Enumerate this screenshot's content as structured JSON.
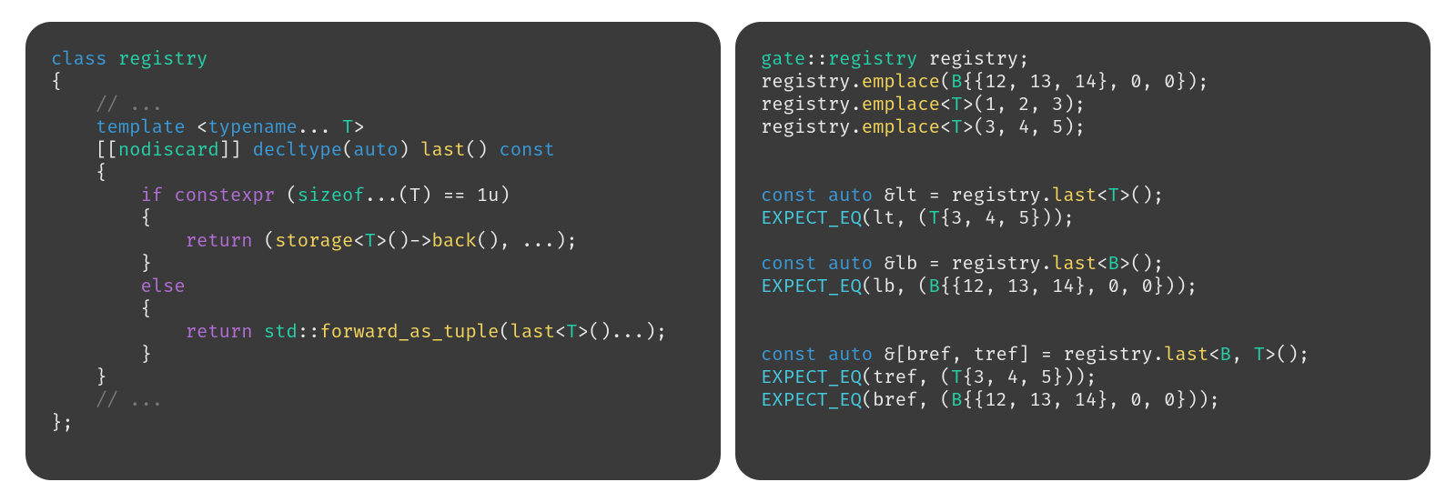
{
  "left": {
    "l1_class": "class",
    "l1_name": " registry",
    "l2": "{",
    "l3_indent": "    ",
    "l3_cm": "// ...",
    "l4_indent": "    ",
    "l4_tmpl": "template",
    "l4_open": " <",
    "l4_typename": "typename",
    "l4_dots": "...",
    "l4_T": " T",
    "l4_close": ">",
    "l5_indent": "    ",
    "l5_attr_open": "[[",
    "l5_attr": "nodiscard",
    "l5_attr_close": "]] ",
    "l5_decltype": "decltype",
    "l5_paren1": "(",
    "l5_auto": "auto",
    "l5_paren2": ") ",
    "l5_last": "last",
    "l5_paren3": "() ",
    "l5_const": "const",
    "l6_indent": "    ",
    "l6": "{",
    "l7_indent": "        ",
    "l7_if": "if",
    "l7_sp": " ",
    "l7_constexpr": "constexpr",
    "l7_sp2": " (",
    "l7_sizeof": "sizeof",
    "l7_dots": "...",
    "l7_pT": "(T) == ",
    "l7_1u": "1u",
    "l7_close": ")",
    "l8_indent": "        ",
    "l8": "{",
    "l9_indent": "            ",
    "l9_return": "return",
    "l9_sp": " (",
    "l9_storage": "storage",
    "l9_tmpl": "<",
    "l9_T": "T",
    "l9_tmplc": ">",
    "l9_call": "()->",
    "l9_back": "back",
    "l9_end": "(), ...);",
    "l10_indent": "        ",
    "l10": "}",
    "l11_indent": "        ",
    "l11_else": "else",
    "l12_indent": "        ",
    "l12": "{",
    "l13_indent": "            ",
    "l13_return": "return",
    "l13_sp": " ",
    "l13_std": "std",
    "l13_cc": "::",
    "l13_fwd": "forward_as_tuple",
    "l13_open": "(",
    "l13_last": "last",
    "l13_tmpl": "<",
    "l13_T": "T",
    "l13_tmplc": ">",
    "l13_end": "()...);",
    "l14_indent": "        ",
    "l14": "}",
    "l15_indent": "    ",
    "l15": "}",
    "l16_indent": "    ",
    "l16_cm": "// ...",
    "l17": "};"
  },
  "right": {
    "r1_ns": "gate",
    "r1_cc": "::",
    "r1_reg": "registry",
    "r1_sp": " registry;",
    "r2_a": "registry.",
    "r2_fn": "emplace",
    "r2_b": "(",
    "r2_B": "B",
    "r2_c": "{{",
    "r2_n": "12, 13, 14",
    "r2_d": "}, ",
    "r2_n2": "0, 0",
    "r2_e": "});",
    "r3_a": "registry.",
    "r3_fn": "emplace",
    "r3_t1": "<",
    "r3_T": "T",
    "r3_t2": ">",
    "r3_b": "(",
    "r3_n": "1, 2, 3",
    "r3_c": ");",
    "r4_a": "registry.",
    "r4_fn": "emplace",
    "r4_t1": "<",
    "r4_T": "T",
    "r4_t2": ">",
    "r4_b": "(",
    "r4_n": "3, 4, 5",
    "r4_c": ");",
    "blank": " ",
    "r6_const": "const",
    "r6_sp": " ",
    "r6_auto": "auto",
    "r6_a": " &lt = registry.",
    "r6_last": "last",
    "r6_t1": "<",
    "r6_T": "T",
    "r6_t2": ">",
    "r6_b": "();",
    "r7_mac": "EXPECT_EQ",
    "r7_a": "(lt, (",
    "r7_T": "T",
    "r7_b": "{",
    "r7_n": "3, 4, 5",
    "r7_c": "}));",
    "r9_const": "const",
    "r9_sp": " ",
    "r9_auto": "auto",
    "r9_a": " &lb = registry.",
    "r9_last": "last",
    "r9_t1": "<",
    "r9_B": "B",
    "r9_t2": ">",
    "r9_b": "();",
    "r10_mac": "EXPECT_EQ",
    "r10_a": "(lb, (",
    "r10_B": "B",
    "r10_b": "{{",
    "r10_n": "12, 13, 14",
    "r10_c": "}, ",
    "r10_n2": "0, 0",
    "r10_d": "}));",
    "r12_const": "const",
    "r12_sp": " ",
    "r12_auto": "auto",
    "r12_a": " &[bref, tref] = registry.",
    "r12_last": "last",
    "r12_t1": "<",
    "r12_B": "B",
    "r12_cm": ", ",
    "r12_T": "T",
    "r12_t2": ">",
    "r12_b": "();",
    "r13_mac": "EXPECT_EQ",
    "r13_a": "(tref, (",
    "r13_T": "T",
    "r13_b": "{",
    "r13_n": "3, 4, 5",
    "r13_c": "}));",
    "r14_mac": "EXPECT_EQ",
    "r14_a": "(bref, (",
    "r14_B": "B",
    "r14_b": "{{",
    "r14_n": "12, 13, 14",
    "r14_c": "}, ",
    "r14_n2": "0, 0",
    "r14_d": "}));"
  }
}
